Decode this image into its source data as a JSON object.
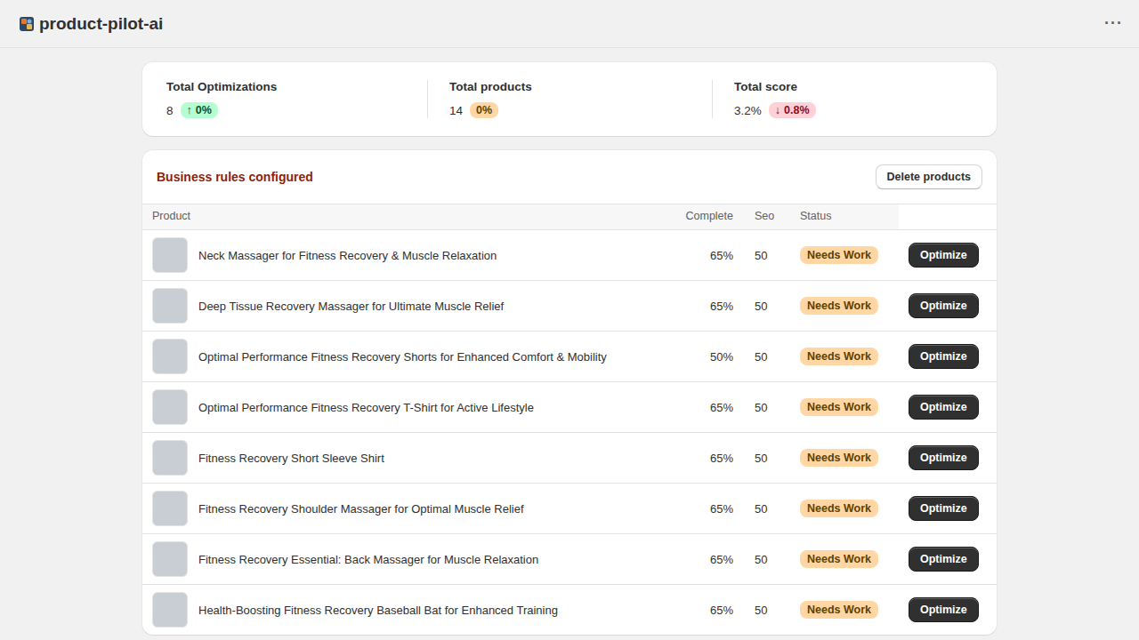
{
  "app": {
    "title": "product-pilot-ai",
    "menu_icon": "···"
  },
  "stats": [
    {
      "label": "Total Optimizations",
      "value": "8",
      "change": "0%",
      "trend_icon": "↑",
      "trend": "up"
    },
    {
      "label": "Total products",
      "value": "14",
      "change": "0%",
      "trend": "flat"
    },
    {
      "label": "Total score",
      "value": "3.2%",
      "change": "0.8%",
      "trend_icon": "↓",
      "trend": "down"
    }
  ],
  "rules_notice": "Business rules configured",
  "delete_button": "Delete products",
  "table": {
    "columns": [
      "Product",
      "Complete",
      "Seo",
      "Status"
    ],
    "rows": [
      {
        "title": "Neck Massager for Fitness Recovery & Muscle Relaxation",
        "complete": "65%",
        "seo": "50",
        "status": "Needs Work",
        "action": "Optimize"
      },
      {
        "title": "Deep Tissue Recovery Massager for Ultimate Muscle Relief",
        "complete": "65%",
        "seo": "50",
        "status": "Needs Work",
        "action": "Optimize"
      },
      {
        "title": "Optimal Performance Fitness Recovery Shorts for Enhanced Comfort & Mobility",
        "complete": "50%",
        "seo": "50",
        "status": "Needs Work",
        "action": "Optimize"
      },
      {
        "title": "Optimal Performance Fitness Recovery T-Shirt for Active Lifestyle",
        "complete": "65%",
        "seo": "50",
        "status": "Needs Work",
        "action": "Optimize"
      },
      {
        "title": "Fitness Recovery Short Sleeve Shirt",
        "complete": "65%",
        "seo": "50",
        "status": "Needs Work",
        "action": "Optimize"
      },
      {
        "title": "Fitness Recovery Shoulder Massager for Optimal Muscle Relief",
        "complete": "65%",
        "seo": "50",
        "status": "Needs Work",
        "action": "Optimize"
      },
      {
        "title": "Fitness Recovery Essential: Back Massager for Muscle Relaxation",
        "complete": "65%",
        "seo": "50",
        "status": "Needs Work",
        "action": "Optimize"
      },
      {
        "title": "Health-Boosting Fitness Recovery Baseball Bat for Enhanced Training",
        "complete": "65%",
        "seo": "50",
        "status": "Needs Work",
        "action": "Optimize"
      }
    ]
  }
}
